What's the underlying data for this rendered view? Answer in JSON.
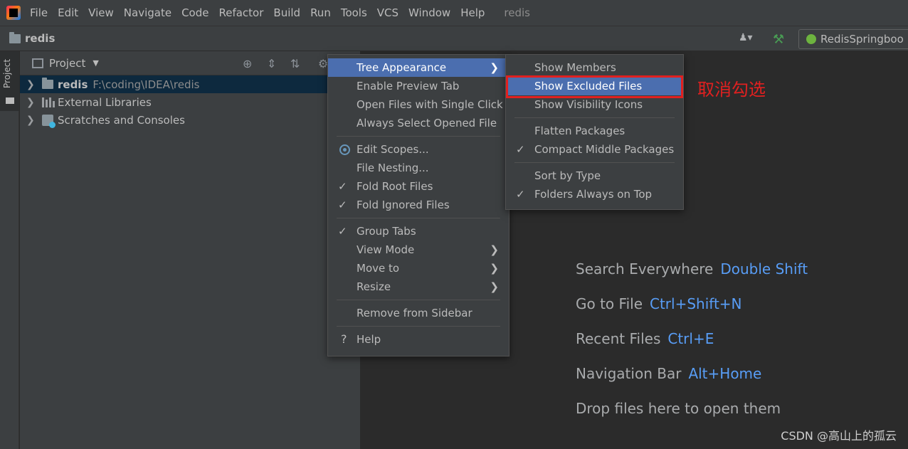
{
  "menubar": {
    "items": [
      "File",
      "Edit",
      "View",
      "Navigate",
      "Code",
      "Refactor",
      "Build",
      "Run",
      "Tools",
      "VCS",
      "Window",
      "Help"
    ],
    "window_title": "redis"
  },
  "navbar": {
    "project": "redis",
    "run_config": "RedisSpringboo"
  },
  "tool_stripe": {
    "project_label": "Project"
  },
  "project_panel": {
    "title": "Project",
    "tree": [
      {
        "name": "redis",
        "path": "F:\\coding\\IDEA\\redis"
      },
      {
        "name": "External Libraries"
      },
      {
        "name": "Scratches and Consoles"
      }
    ]
  },
  "gear_menu": {
    "items": [
      {
        "label": "Tree Appearance",
        "submenu": true,
        "active": true
      },
      {
        "label": "Enable Preview Tab"
      },
      {
        "label": "Open Files with Single Click"
      },
      {
        "label": "Always Select Opened File"
      },
      {
        "label": "Edit Scopes..."
      },
      {
        "label": "File Nesting..."
      },
      {
        "label": "Fold Root Files",
        "checked": true
      },
      {
        "label": "Fold Ignored Files",
        "checked": true
      },
      {
        "label": "Group Tabs",
        "checked": true
      },
      {
        "label": "View Mode",
        "submenu": true
      },
      {
        "label": "Move to",
        "submenu": true
      },
      {
        "label": "Resize",
        "submenu": true
      },
      {
        "label": "Remove from Sidebar"
      },
      {
        "label": "Help"
      }
    ]
  },
  "tree_appearance_menu": {
    "items": [
      {
        "label": "Show Members"
      },
      {
        "label": "Show Excluded Files",
        "active": true
      },
      {
        "label": "Show Visibility Icons"
      },
      {
        "label": "Flatten Packages"
      },
      {
        "label": "Compact Middle Packages",
        "checked": true
      },
      {
        "label": "Sort by Type"
      },
      {
        "label": "Folders Always on Top",
        "checked": true
      }
    ]
  },
  "annotation": "取消勾选",
  "editor_hints": [
    {
      "text": "Search Everywhere",
      "key": "Double Shift"
    },
    {
      "text": "Go to File",
      "key": "Ctrl+Shift+N"
    },
    {
      "text": "Recent Files",
      "key": "Ctrl+E"
    },
    {
      "text": "Navigation Bar",
      "key": "Alt+Home"
    },
    {
      "text": "Drop files here to open them",
      "key": ""
    }
  ],
  "watermark": "CSDN @高山上的孤云",
  "colors": {
    "selection": "#4b6eaf",
    "highlight_border": "#e02020",
    "shortcut": "#589df6"
  }
}
